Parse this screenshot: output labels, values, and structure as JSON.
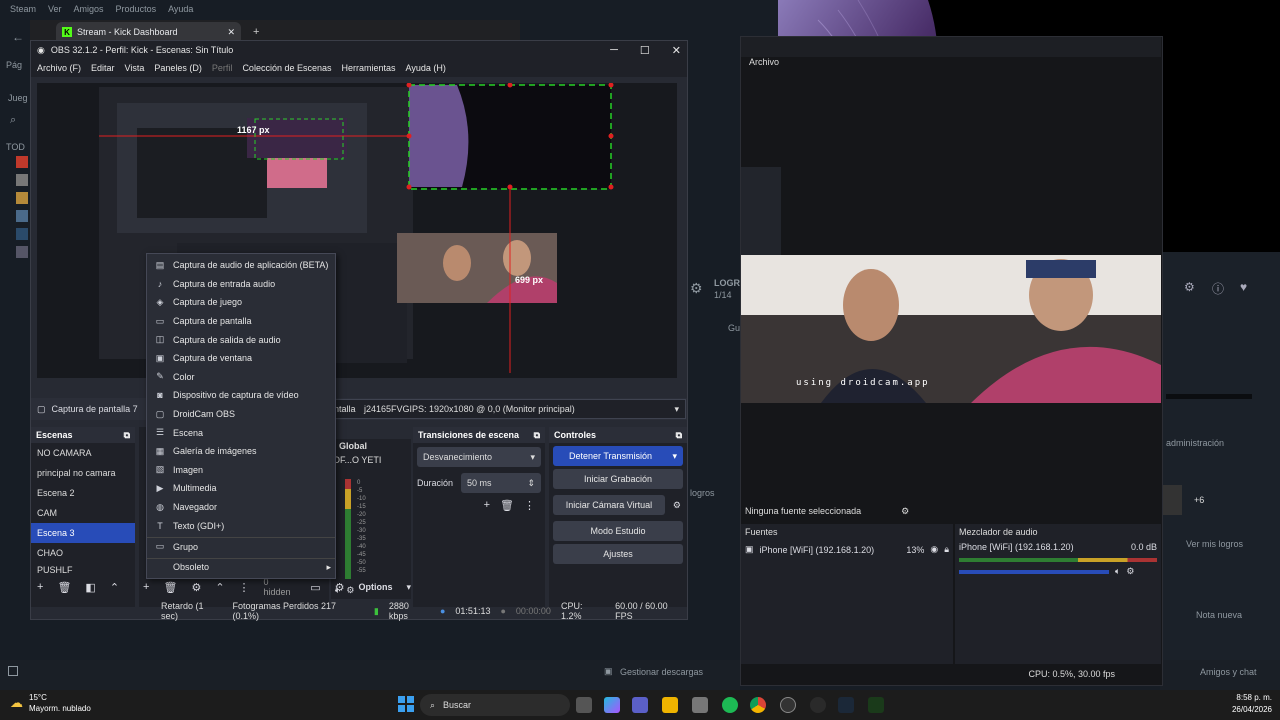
{
  "steam": {
    "menu": [
      "Steam",
      "Ver",
      "Amigos",
      "Productos",
      "Ayuda"
    ],
    "left_labels": [
      "Pág",
      "Jueg"
    ],
    "todo": "TOD",
    "logro": "LOGR",
    "logro_count": "1/14",
    "gu": "Gu",
    "admin": "administración",
    "plus": "+6",
    "logros": "logros",
    "ver_logros": "Ver mis logros",
    "nota": "Nota nueva",
    "descargas": "Gestionar descargas",
    "amigos": "Amigos y chat"
  },
  "browser": {
    "tab_title": "Stream - Kick Dashboard"
  },
  "obs": {
    "title": "OBS 32.1.2 - Perfil: Kick - Escenas: Sin Título",
    "menu": [
      "Archivo (F)",
      "Editar",
      "Vista",
      "Paneles (D)",
      "Perfil",
      "Colección de Escenas",
      "Herramientas",
      "Ayuda (H)"
    ],
    "preview": {
      "px_h": "1167 px",
      "px_v": "699 px",
      "droidcam_caption": "using droidcam.app"
    },
    "source_name": "Captura de pantalla 7",
    "screen_label": "ntalla",
    "source_prop": "j24165FVGIPS: 1920x1080 @ 0,0 (Monitor principal)",
    "scenes": {
      "title": "Escenas",
      "items": [
        "NO CAMARA",
        "principal no camara",
        "Escena 2",
        "CAM",
        "Escena 3",
        "CHAO",
        "PUSHLF"
      ],
      "selected_index": 4
    },
    "mixer_mini": {
      "label": "Global",
      "channel": "OF...O YETI"
    },
    "transitions": {
      "title": "Transiciones de escena",
      "type": "Desvanecimiento",
      "duration_label": "Duración",
      "duration_value": "50 ms"
    },
    "controls": {
      "title": "Controles",
      "stop_stream": "Detener Transmisión",
      "start_recording": "Iniciar Grabación",
      "virtual_cam": "Iniciar Cámara Virtual",
      "studio_mode": "Modo Estudio",
      "settings": "Ajustes"
    },
    "source_toolbar": {
      "hidden": "0 hidden",
      "options": "Options"
    },
    "status": {
      "delay": "Retardo (1 sec)",
      "dropped": "Fotogramas Perdidos 217 (0.1%)",
      "bitrate": "2880 kbps",
      "stream_time": "01:51:13",
      "rec_time": "00:00:00",
      "cpu": "CPU: 1.2%",
      "fps": "60.00 / 60.00 FPS"
    },
    "context_menu": [
      {
        "label": "Captura de audio de aplicación (BETA)",
        "icon": "app-audio-icon"
      },
      {
        "label": "Captura de entrada audio",
        "icon": "mic-icon"
      },
      {
        "label": "Captura de juego",
        "icon": "gamepad-icon"
      },
      {
        "label": "Captura de pantalla",
        "icon": "monitor-icon"
      },
      {
        "label": "Captura de salida de audio",
        "icon": "speaker-icon"
      },
      {
        "label": "Captura de ventana",
        "icon": "window-icon"
      },
      {
        "label": "Color",
        "icon": "brush-icon"
      },
      {
        "label": "Dispositivo de captura de vídeo",
        "icon": "camera-icon"
      },
      {
        "label": "DroidCam OBS",
        "icon": "droidcam-icon"
      },
      {
        "label": "Escena",
        "icon": "scene-icon"
      },
      {
        "label": "Galería de imágenes",
        "icon": "gallery-icon"
      },
      {
        "label": "Imagen",
        "icon": "image-icon"
      },
      {
        "label": "Multimedia",
        "icon": "play-icon"
      },
      {
        "label": "Navegador",
        "icon": "globe-icon"
      },
      {
        "label": "Texto (GDI+)",
        "icon": "text-icon"
      },
      {
        "label": "Grupo",
        "icon": "folder-icon"
      },
      {
        "label": "Obsoleto",
        "icon": ""
      }
    ]
  },
  "projector": {
    "menu": "Archivo",
    "no_source": "Ninguna fuente seleccionada",
    "fuentes_title": "Fuentes",
    "fuente_item": "iPhone [WiFi] (192.168.1.20)",
    "fuente_battery": "13%",
    "mixer_title": "Mezclador de audio",
    "mixer_channel": "iPhone [WiFi] (192.168.1.20)",
    "mixer_db": "0.0 dB",
    "status": "CPU: 0.5%, 30.00 fps",
    "video_caption": "using droidcam.app"
  },
  "taskbar": {
    "temp": "15°C",
    "weather": "Mayorm. nublado",
    "search": "Buscar",
    "time": "8:58 p. m.",
    "date": "26/04/2026"
  }
}
